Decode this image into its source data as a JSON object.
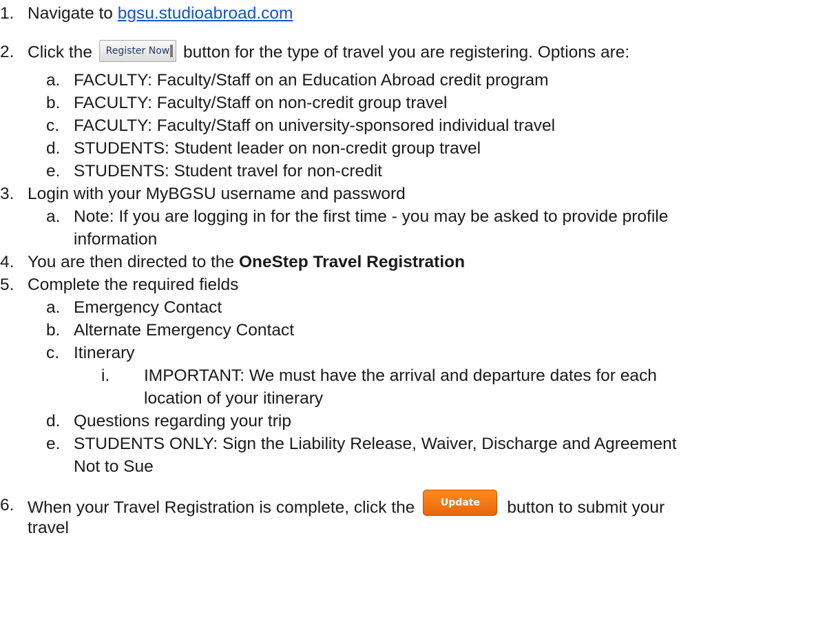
{
  "steps": [
    {
      "num": "1.",
      "text": "Navigate to ",
      "link": "bgsu.studioabroad.com"
    },
    {
      "num": "2.",
      "text_before": "Click the",
      "button": "Register Now",
      "text_after": "button for the type of travel you are registering. Options are:",
      "options": [
        {
          "letter": "a.",
          "text": "FACULTY: Faculty/Staff on an Education Abroad credit program"
        },
        {
          "letter": "b.",
          "text": "FACULTY: Faculty/Staff on non-credit group travel"
        },
        {
          "letter": "c.",
          "text": "FACULTY: Faculty/Staff on university-sponsored individual travel"
        },
        {
          "letter": "d.",
          "text": "STUDENTS: Student leader on non-credit group travel"
        },
        {
          "letter": "e.",
          "text": "STUDENTS: Student travel for non-credit"
        }
      ]
    },
    {
      "num": "3.",
      "text": "Login with your MyBGSU username and password",
      "sub": {
        "letter": "a.",
        "line1": "Note: If you are logging in for the first time - you may be asked to provide profile",
        "line2": "information"
      }
    },
    {
      "num": "4.",
      "text": "You are then directed to the ",
      "bold": "OneStep Travel Registration"
    },
    {
      "num": "5.",
      "text": "Complete the required fields",
      "fields": [
        {
          "letter": "a.",
          "text": "Emergency Contact"
        },
        {
          "letter": "b.",
          "text": "Alternate Emergency Contact"
        },
        {
          "letter": "c.",
          "text": "Itinerary"
        }
      ],
      "itinerary_note": {
        "roman": "i.",
        "line1": "IMPORTANT: We must have the arrival and departure dates for each",
        "line2": "location of your itinerary"
      },
      "fields_after": [
        {
          "letter": "d.",
          "text": "Questions regarding your trip"
        },
        {
          "letter": "e.",
          "line1": "STUDENTS ONLY: Sign the Liability Release, Waiver, Discharge and Agreement",
          "line2": "Not to Sue"
        }
      ]
    },
    {
      "num": "6.",
      "text_before": "When your Travel Registration is complete, click the",
      "button": "Update",
      "text_after": "button to submit your",
      "line2": "travel"
    }
  ]
}
